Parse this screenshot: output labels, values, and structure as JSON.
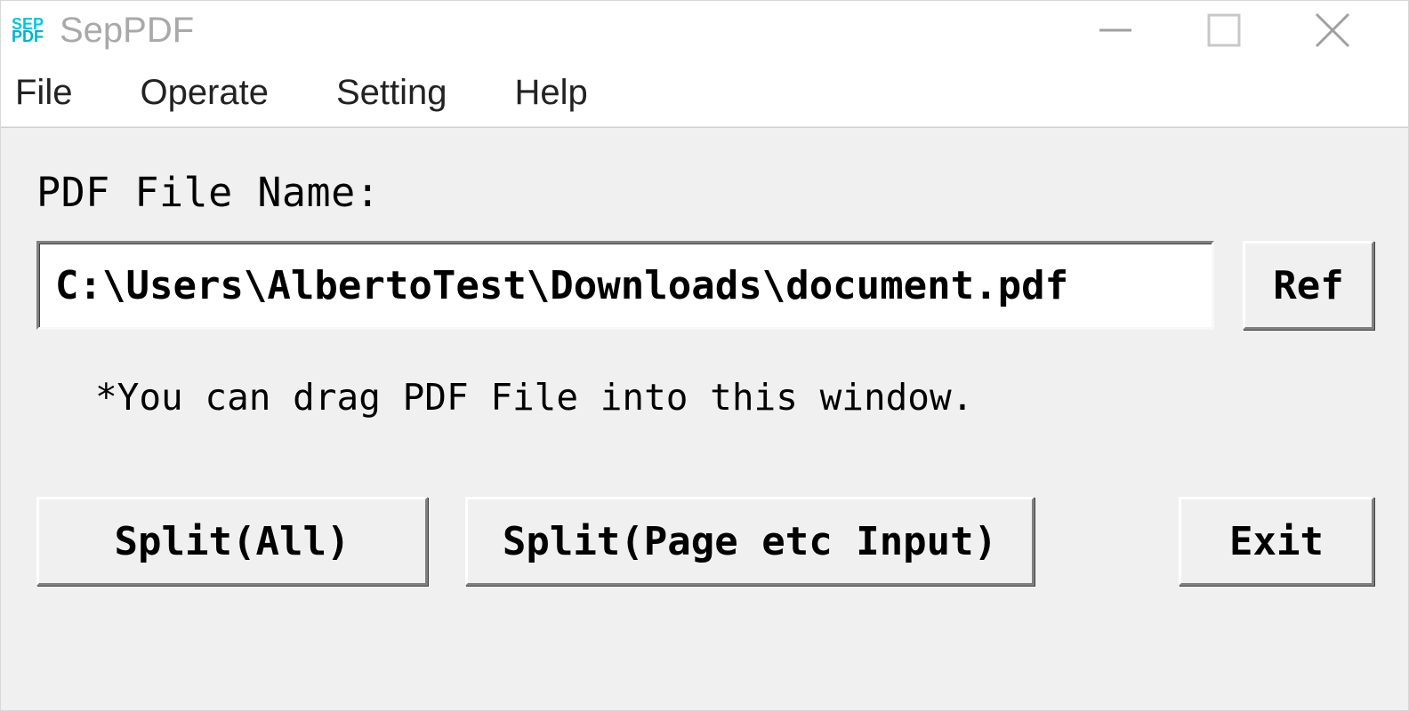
{
  "window": {
    "title": "SepPDF",
    "icon_line1": "SEP",
    "icon_line2": "PDF"
  },
  "menu": {
    "file": "File",
    "operate": "Operate",
    "setting": "Setting",
    "help": "Help"
  },
  "main": {
    "label_filename": "PDF File Name:",
    "file_path": "C:\\Users\\AlbertoTest\\Downloads\\document.pdf",
    "ref_button": "Ref",
    "drag_hint": "*You can drag PDF File into this window.",
    "split_all": "Split(All)",
    "split_page": "Split(Page etc Input)",
    "exit": "Exit"
  }
}
